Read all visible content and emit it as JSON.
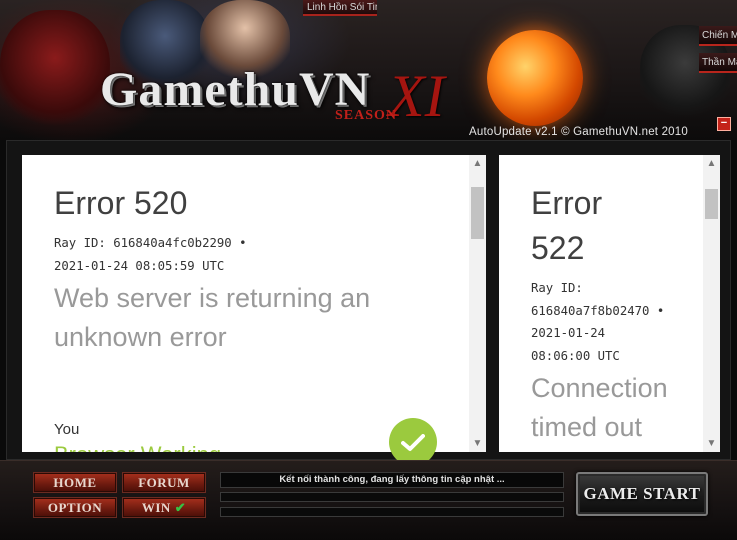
{
  "header": {
    "logo_text": "GamethuVN",
    "logo_season": "SEASON",
    "logo_roman": "XI",
    "top_tab": "Linh Hồn Sói Tinh",
    "right_tabs": [
      "Chiến Mã",
      "Thần Mã"
    ],
    "close_label": "−",
    "version": "AutoUpdate v2.1 © GamethuVN.net 2010"
  },
  "left_panel": {
    "title": "Error 520",
    "ray_line": "Ray ID: 616840a4fc0b2290 •",
    "time_line": "2021-01-24 08:05:59 UTC",
    "desc_lines": [
      "Web server is returning an",
      "unknown error"
    ],
    "you_label": "You",
    "you_status": "Browser Working"
  },
  "right_panel": {
    "title_lines": [
      "Error",
      "522"
    ],
    "ray_label": "Ray ID:",
    "ray_value": "616840a7f8b02470 •",
    "date": "2021-01-24",
    "time": "08:06:00 UTC",
    "desc_lines": [
      "Connection",
      "timed out"
    ]
  },
  "nav": {
    "home": "HOME",
    "forum": "FORUM",
    "option": "OPTION",
    "win": "WIN",
    "win_check": "✔"
  },
  "status": {
    "message": "Kết nối thành công, đang lấy thông tin cập nhật ...",
    "progress_1": 0,
    "progress_2": 0
  },
  "game_start": "GAME START",
  "colors": {
    "accent_red": "#a8301d",
    "success_green": "#9bca3e",
    "working_green": "#9bca3e"
  }
}
